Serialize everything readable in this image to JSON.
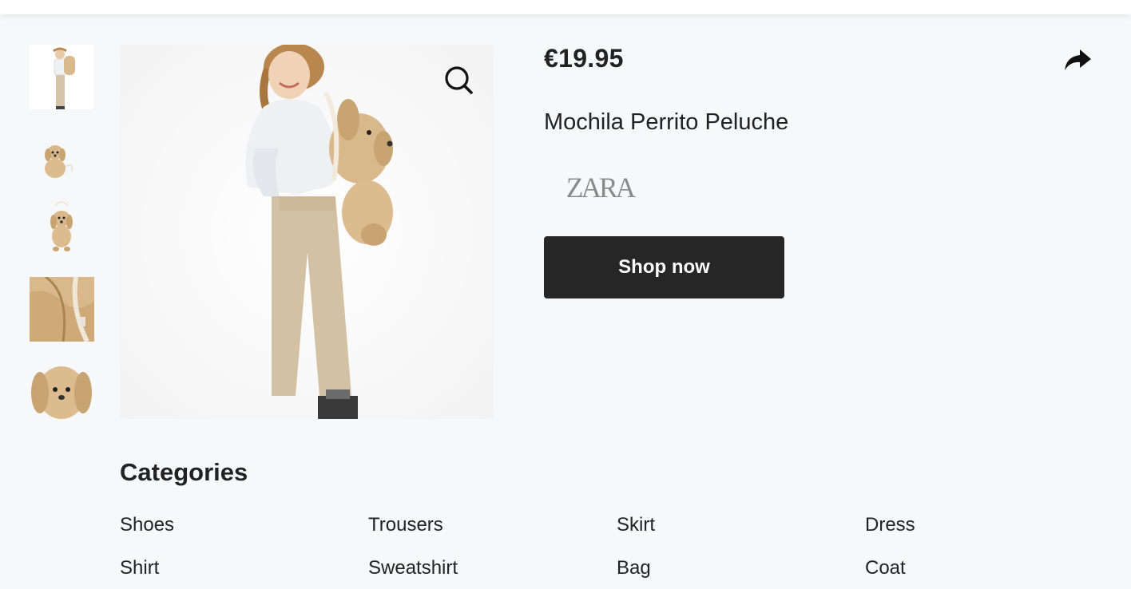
{
  "product": {
    "price": "€19.95",
    "title": "Mochila Perrito Peluche",
    "brand": "ZARA",
    "shop_label": "Shop now"
  },
  "icons": {
    "zoom": "magnifier-icon",
    "share": "share-arrow-icon"
  },
  "gallery": {
    "thumbnails": [
      {
        "name": "child-with-backpack"
      },
      {
        "name": "backpack-front-small"
      },
      {
        "name": "backpack-full"
      },
      {
        "name": "backpack-zipper-closeup"
      },
      {
        "name": "backpack-face-closeup"
      }
    ]
  },
  "categories": {
    "heading": "Categories",
    "items": [
      "Shoes",
      "Trousers",
      "Skirt",
      "Dress",
      "Shirt",
      "Sweatshirt",
      "Bag",
      "Coat"
    ]
  },
  "colors": {
    "background": "#f7f8f9",
    "button": "#262626",
    "plush": "#d9b98c"
  }
}
